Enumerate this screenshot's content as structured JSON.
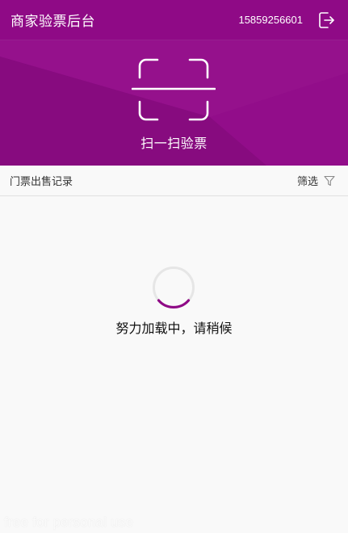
{
  "header": {
    "title": "商家验票后台",
    "phone": "15859256601",
    "logout_icon": "logout-icon"
  },
  "scan": {
    "label": "扫一扫验票",
    "icon": "scan-frame-icon"
  },
  "records": {
    "title": "门票出售记录",
    "filter_label": "筛选",
    "filter_icon": "funnel-icon"
  },
  "loading": {
    "text": "努力加载中，请稍候"
  },
  "watermark": "free for personal use",
  "colors": {
    "brand": "#8f0a86",
    "spinner_track": "#e6e6e6",
    "spinner_arc": "#8f0a86",
    "background": "#f9f9f9"
  }
}
